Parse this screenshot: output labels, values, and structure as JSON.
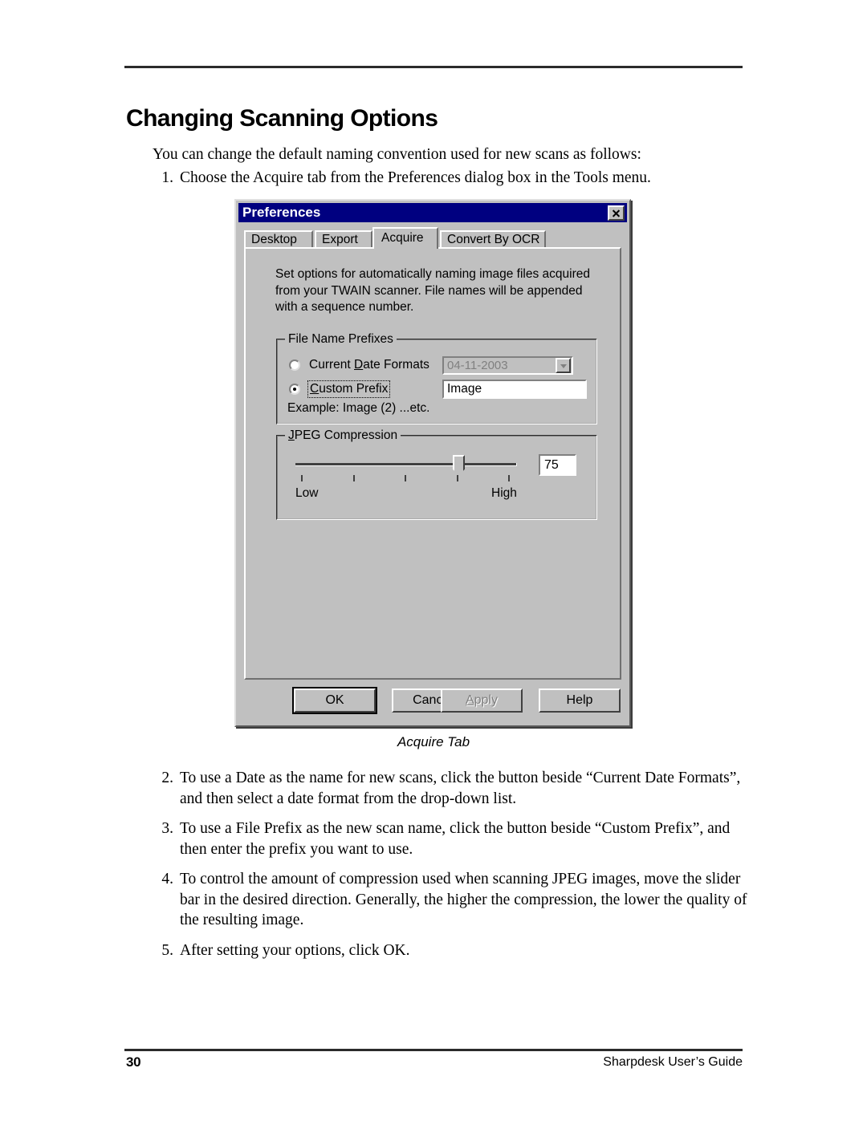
{
  "document": {
    "title": "Changing Scanning Options",
    "intro": "You can change the default naming convention used for new scans as follows:",
    "caption": "Acquire Tab",
    "footer": {
      "page_number": "30",
      "guide_name": "Sharpdesk User’s Guide"
    },
    "steps": [
      {
        "num": "1.",
        "text": "Choose the Acquire tab from the Preferences dialog box in the Tools menu."
      },
      {
        "num": "2.",
        "text": "To use a Date as the name for new scans, click the button beside “Current Date Formats”, and then select a date format from the drop-down list."
      },
      {
        "num": "3.",
        "text": "To use a File Prefix as the new scan name, click the button beside “Custom Prefix”, and then enter the prefix you want to use."
      },
      {
        "num": "4.",
        "text": "To control the amount of compression used when scanning JPEG images, move the slider bar in the desired direction.  Generally, the higher the compression, the lower the quality of the resulting image."
      },
      {
        "num": "5.",
        "text": "After setting your options, click OK."
      }
    ]
  },
  "dialog": {
    "title": "Preferences",
    "close_icon": "close-icon",
    "tabs": [
      {
        "label": "Desktop",
        "selected": false
      },
      {
        "label": "Export",
        "selected": false
      },
      {
        "label": "Acquire",
        "selected": true
      },
      {
        "label": "Convert By OCR",
        "selected": false
      }
    ],
    "description": "Set options for automatically naming image files acquired from your TWAIN scanner. File names will be appended with a sequence number.",
    "file_name_prefixes": {
      "group_title": "File Name Prefixes",
      "date_radio": {
        "label_before": "Current ",
        "label_accel": "D",
        "label_after": "ate Formats",
        "selected": false
      },
      "date_combo": {
        "value": "04-11-2003",
        "enabled": false,
        "arrow_icon": "chevron-down-icon"
      },
      "custom_radio": {
        "label_accel": "C",
        "label_after": "ustom Prefix",
        "selected": true,
        "focused": true
      },
      "custom_input": {
        "value": "Image"
      },
      "example": "Example: Image (2) ...etc."
    },
    "jpeg_compression": {
      "group_title_accel": "J",
      "group_title_after": "PEG Compression",
      "low_label": "Low",
      "high_label": "High",
      "value": "75",
      "slider_percent": 75,
      "tick_count": 5
    },
    "buttons": [
      {
        "label": "OK",
        "state": "default"
      },
      {
        "label": "Cancel",
        "state": "normal"
      },
      {
        "label": "Apply",
        "state": "disabled",
        "accel": "A"
      },
      {
        "label": "Help",
        "state": "normal"
      }
    ],
    "colors": {
      "titlebar": "#000080",
      "face": "#c0c0c0",
      "shadow": "#808080",
      "highlight": "#ffffff",
      "text": "#000000",
      "disabled_text": "#808080"
    }
  }
}
